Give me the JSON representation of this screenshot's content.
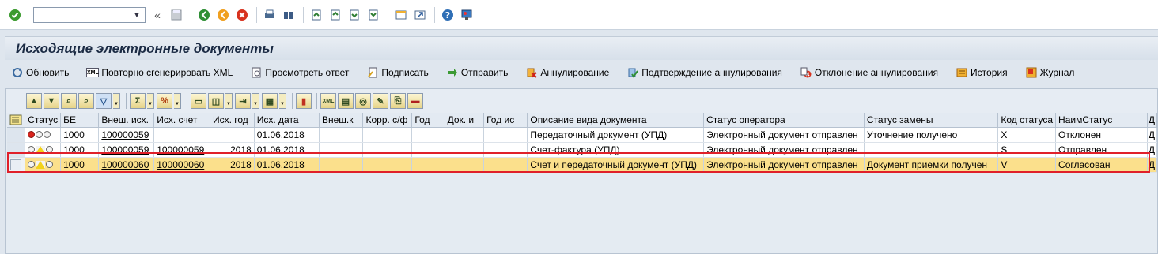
{
  "toolbar": {
    "command_field_value": "",
    "icons": [
      "enter-icon",
      "back-icon",
      "save-icon",
      "back-nav-icon",
      "exit-icon",
      "cancel-icon",
      "print-icon",
      "find-icon",
      "find-next-icon",
      "first-page-icon",
      "prev-page-icon",
      "next-page-icon",
      "last-page-icon",
      "new-session-icon",
      "shortcut-icon",
      "help-icon",
      "layout-icon"
    ]
  },
  "title": "Исходящие электронные документы",
  "app_toolbar": [
    {
      "label": "Обновить",
      "icon": "refresh-icon"
    },
    {
      "label": "Повторно сгенерировать XML",
      "icon": "xml-icon"
    },
    {
      "label": "Просмотреть ответ",
      "icon": "view-response-icon"
    },
    {
      "label": "Подписать",
      "icon": "sign-icon"
    },
    {
      "label": "Отправить",
      "icon": "send-icon"
    },
    {
      "label": "Аннулирование",
      "icon": "annul-icon"
    },
    {
      "label": "Подтверждение аннулирования",
      "icon": "confirm-annul-icon"
    },
    {
      "label": "Отклонение аннулирования",
      "icon": "reject-annul-icon"
    },
    {
      "label": "История",
      "icon": "history-icon"
    },
    {
      "label": "Журнал",
      "icon": "journal-icon"
    }
  ],
  "grid": {
    "columns": [
      "Статус",
      "БЕ",
      "Внеш. исх.",
      "Исх. счет",
      "Исх. год",
      "Исх. дата",
      "Внеш.к",
      "Корр. с/ф",
      "Год",
      "Док. и",
      "Год ис",
      "Описание вида документа",
      "Статус оператора",
      "Статус замены",
      "Код статуса",
      "НаимСтатус",
      "Д"
    ],
    "rows": [
      {
        "status": "red",
        "be": "1000",
        "ext_out": "100000059",
        "out_invoice": "",
        "out_year": "",
        "out_date": "01.06.2018",
        "doc_desc": "Передаточный документ (УПД)",
        "operator_status": "Электронный документ отправлен",
        "replace_status": "Уточнение получено",
        "status_code": "X",
        "status_name": "Отклонен",
        "extra": "Д"
      },
      {
        "status": "yellow",
        "be": "1000",
        "ext_out": "100000059",
        "out_invoice": "100000059",
        "out_year": "2018",
        "out_date": "01.06.2018",
        "doc_desc": "Счет-фактура (УПД)",
        "operator_status": "Электронный документ отправлен",
        "replace_status": "",
        "status_code": "S",
        "status_name": "Отправлен",
        "extra": "Д"
      },
      {
        "status": "yellow",
        "be": "1000",
        "ext_out": "100000060",
        "out_invoice": "100000060",
        "out_year": "2018",
        "out_date": "01.06.2018",
        "doc_desc": "Счет и передаточный документ (УПД)",
        "operator_status": "Электронный документ отправлен",
        "replace_status": "Документ приемки получен",
        "status_code": "V",
        "status_name": "Согласован",
        "extra": "Д"
      }
    ]
  },
  "colors": {
    "highlight_row": "#fbe08c",
    "highlight_frame": "#e0202a"
  }
}
